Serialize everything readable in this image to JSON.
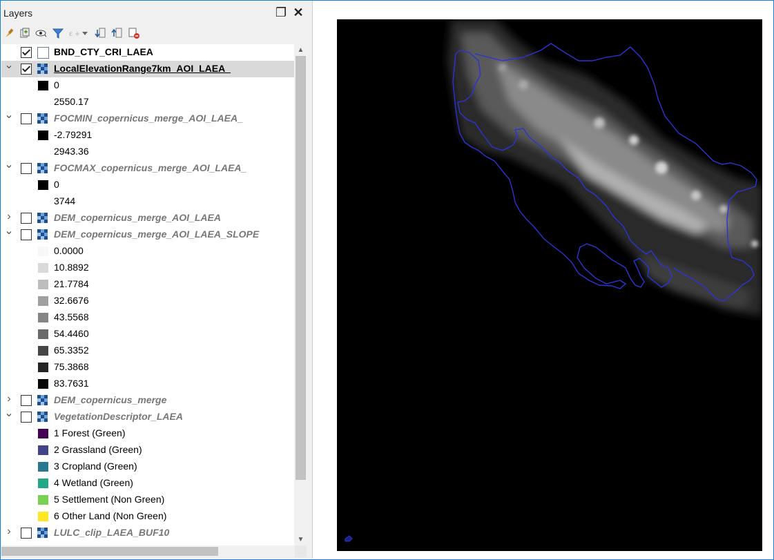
{
  "panel": {
    "title": "Layers",
    "float_icon": "❐",
    "close_icon": "✕"
  },
  "toolbar": {
    "icons": [
      "style-paint-icon",
      "add-group-icon",
      "manage-visibility-icon",
      "filter-icon",
      "expression-filter-icon",
      "dropdown-icon",
      "expand-all-icon",
      "collapse-all-icon",
      "remove-layer-icon"
    ]
  },
  "layers": [
    {
      "name": "BND_CTY_CRI_LAEA",
      "type": "vector",
      "checked": true,
      "expanded": null,
      "style": "bold"
    },
    {
      "name": "LocalElevationRange7km_AOI_LAEA_",
      "type": "raster",
      "checked": true,
      "expanded": true,
      "style": "selected",
      "legend": [
        {
          "label": "0",
          "color": "#000000"
        },
        {
          "label": "2550.17",
          "color": "#ffffff"
        }
      ]
    },
    {
      "name": "FOCMIN_copernicus_merge_AOI_LAEA_",
      "type": "raster",
      "checked": false,
      "expanded": true,
      "style": "italic",
      "legend": [
        {
          "label": "-2.79291",
          "color": "#000000"
        },
        {
          "label": "2943.36",
          "color": "#ffffff"
        }
      ]
    },
    {
      "name": "FOCMAX_copernicus_merge_AOI_LAEA_",
      "type": "raster",
      "checked": false,
      "expanded": true,
      "style": "italic",
      "legend": [
        {
          "label": "0",
          "color": "#000000"
        },
        {
          "label": "3744",
          "color": "#ffffff"
        }
      ]
    },
    {
      "name": "DEM_copernicus_merge_AOI_LAEA",
      "type": "raster",
      "checked": false,
      "expanded": false,
      "style": "italic"
    },
    {
      "name": "DEM_copernicus_merge_AOI_LAEA_SLOPE",
      "type": "raster",
      "checked": false,
      "expanded": true,
      "style": "italic",
      "legend": [
        {
          "label": "0.0000",
          "color": "#f7f7f7"
        },
        {
          "label": "10.8892",
          "color": "#d9d9d9"
        },
        {
          "label": "21.7784",
          "color": "#bdbdbd"
        },
        {
          "label": "32.6676",
          "color": "#a0a0a0"
        },
        {
          "label": "43.5568",
          "color": "#858585"
        },
        {
          "label": "54.4460",
          "color": "#696969"
        },
        {
          "label": "65.3352",
          "color": "#454545"
        },
        {
          "label": "75.3868",
          "color": "#252525"
        },
        {
          "label": "83.7631",
          "color": "#080808"
        }
      ]
    },
    {
      "name": "DEM_copernicus_merge",
      "type": "raster",
      "checked": false,
      "expanded": false,
      "style": "italic"
    },
    {
      "name": "VegetationDescriptor_LAEA",
      "type": "raster",
      "checked": false,
      "expanded": true,
      "style": "italic",
      "legend": [
        {
          "label": "1 Forest (Green)",
          "color": "#440154"
        },
        {
          "label": "2 Grassland (Green)",
          "color": "#414487"
        },
        {
          "label": "3 Cropland (Green)",
          "color": "#2a788e"
        },
        {
          "label": "4 Wetland (Green)",
          "color": "#22a884"
        },
        {
          "label": "5 Settlement (Non Green)",
          "color": "#7ad151"
        },
        {
          "label": "6 Other Land (Non Green)",
          "color": "#fde725"
        }
      ]
    },
    {
      "name": "LULC_clip_LAEA_BUF10",
      "type": "raster",
      "checked": false,
      "expanded": false,
      "style": "italic"
    }
  ],
  "colors": {
    "frame_border": "#1a7fd4",
    "country_outline": "#2b34d6",
    "map_background": "#000000"
  },
  "map": {
    "layer_shown": "LocalElevationRange7km_AOI_LAEA_",
    "outline_layer": "BND_CTY_CRI_LAEA"
  }
}
